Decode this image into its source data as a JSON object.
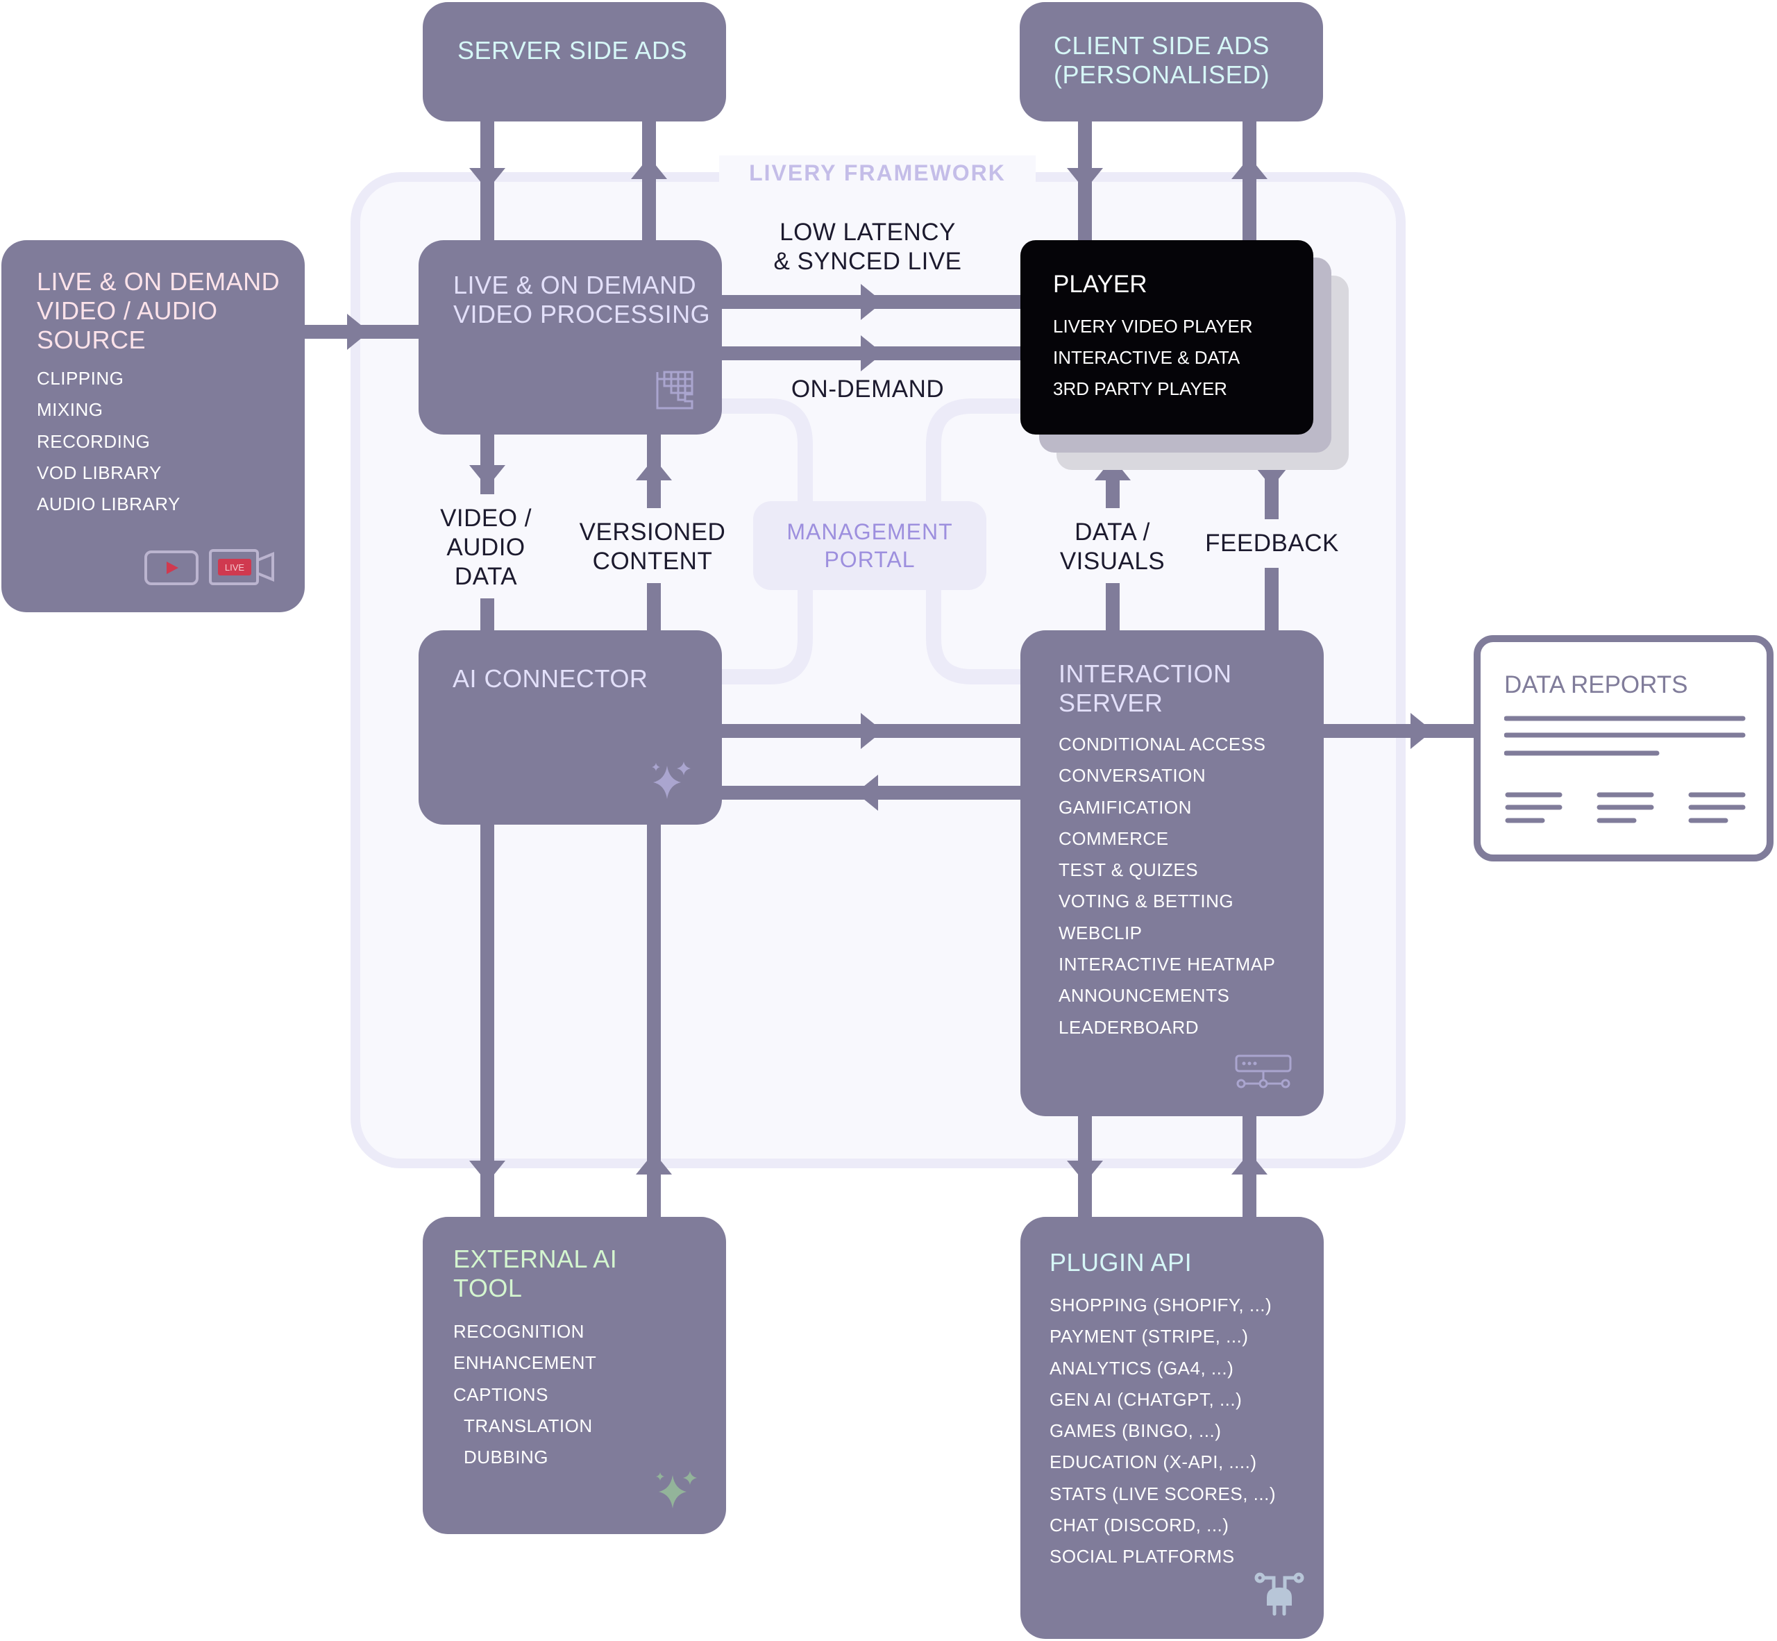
{
  "framework": {
    "title": "LIVERY FRAMEWORK"
  },
  "colors": {
    "box": "#807c9a",
    "frame_border": "#ecebf8",
    "frame_bg": "#f8f8fd",
    "player_bg": "#050408",
    "title_pink": "#fde3ea",
    "title_lavender": "#e3e0fa",
    "title_cyan": "#d6f7f7",
    "title_green": "#d4f6cf",
    "live_red": "#d0394f",
    "sparkle_lavender": "#aaa5cf",
    "sparkle_green": "#93b49a",
    "plug_blue": "#b8c6d8"
  },
  "boxes": {
    "server_side_ads": {
      "title": "SERVER SIDE ADS"
    },
    "client_side_ads": {
      "title_lines": [
        "CLIENT SIDE ADS",
        "(PERSONALISED)"
      ]
    },
    "source": {
      "title_lines": [
        "LIVE & ON DEMAND",
        "VIDEO / AUDIO",
        "SOURCE"
      ],
      "items": [
        "CLIPPING",
        "MIXING",
        "RECORDING",
        "VOD LIBRARY",
        "AUDIO LIBRARY"
      ],
      "icons": [
        "play-button-icon",
        "live-camera-icon"
      ],
      "live_badge": "LIVE"
    },
    "processing": {
      "title_lines": [
        "LIVE & ON DEMAND",
        "VIDEO PROCESSING"
      ],
      "icon": "pixel-grid-icon"
    },
    "player": {
      "title": "PLAYER",
      "items": [
        "LIVERY VIDEO PLAYER",
        "INTERACTIVE & DATA",
        "3RD PARTY PLAYER"
      ]
    },
    "management_portal": {
      "title_lines": [
        "MANAGEMENT",
        "PORTAL"
      ]
    },
    "ai_connector": {
      "title": "AI CONNECTOR",
      "icon": "sparkle-icon"
    },
    "interaction_server": {
      "title_lines": [
        "INTERACTION",
        "SERVER"
      ],
      "items": [
        "CONDITIONAL ACCESS",
        "CONVERSATION",
        "GAMIFICATION",
        "COMMERCE",
        "TEST & QUIZES",
        "VOTING & BETTING",
        "WEBCLIP",
        "INTERACTIVE HEATMAP",
        "ANNOUNCEMENTS",
        "LEADERBOARD"
      ],
      "icon": "server-network-icon"
    },
    "data_reports": {
      "title": "DATA REPORTS"
    },
    "external_ai": {
      "title_lines": [
        "EXTERNAL AI",
        "TOOL"
      ],
      "items": [
        "RECOGNITION",
        "ENHANCEMENT",
        "CAPTIONS"
      ],
      "sub_items": [
        "TRANSLATION",
        "DUBBING"
      ],
      "icon": "sparkle-icon"
    },
    "plugin_api": {
      "title": "PLUGIN API",
      "items": [
        "SHOPPING (SHOPIFY, ...)",
        "PAYMENT (STRIPE, ...)",
        "ANALYTICS (GA4, ...)",
        "GEN AI (CHATGPT, ...)",
        "GAMES (BINGO, ...)",
        "EDUCATION (X-API, ....)",
        "STATS (LIVE SCORES, ...)",
        "CHAT (DISCORD, ...)",
        "SOCIAL PLATFORMS"
      ],
      "icon": "plug-icon"
    }
  },
  "edges": {
    "low_latency": [
      "LOW LATENCY",
      "& SYNCED LIVE"
    ],
    "on_demand": "ON-DEMAND",
    "video_audio_data": [
      "VIDEO /",
      "AUDIO",
      "DATA"
    ],
    "versioned_content": [
      "VERSIONED",
      "CONTENT"
    ],
    "data_visuals": [
      "DATA /",
      "VISUALS"
    ],
    "feedback": "FEEDBACK"
  }
}
